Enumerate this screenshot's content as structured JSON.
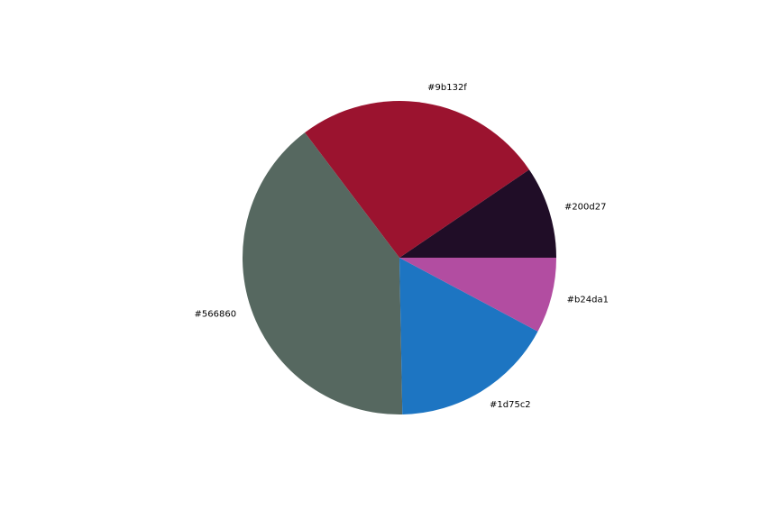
{
  "chart_data": {
    "type": "pie",
    "title": "",
    "start_angle_deg": 0,
    "direction": "counterclockwise",
    "slices": [
      {
        "label": "#200d27",
        "value": 9.5,
        "color": "#200d27"
      },
      {
        "label": "#9b132f",
        "value": 25.8,
        "color": "#9b132f"
      },
      {
        "label": "#566860",
        "value": 40.0,
        "color": "#566860"
      },
      {
        "label": "#1d75c2",
        "value": 16.9,
        "color": "#1d75c2"
      },
      {
        "label": "#b24da1",
        "value": 7.8,
        "color": "#b24da1"
      }
    ]
  }
}
